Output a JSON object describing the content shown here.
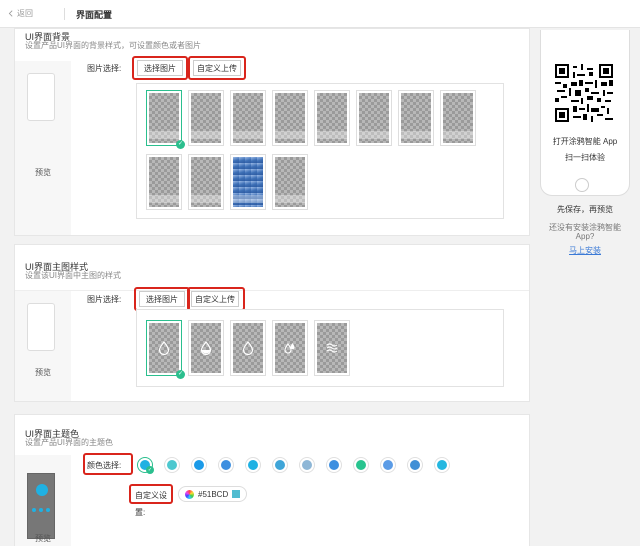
{
  "topbar": {
    "back_label": "返回",
    "title": "界面配置"
  },
  "bg_section": {
    "title": "UI界面背景",
    "desc": "设置产品UI界面的背景样式，可设置颜色或者图片",
    "preview_label": "预览",
    "field_label": "图片选择:",
    "btn_select": "选择图片",
    "btn_upload": "自定义上传",
    "selected_index": 0
  },
  "main_section": {
    "title": "UI界面主图样式",
    "desc": "设置该UI界面中主图的样式",
    "preview_label": "预览",
    "field_label": "图片选择:",
    "btn_select": "选择图片",
    "btn_upload": "自定义上传",
    "icons": [
      "drop-outline-icon",
      "drop-half-icon",
      "drop-outline-icon",
      "two-drops-icon",
      "waves-icon"
    ]
  },
  "theme_section": {
    "title": "UI界面主题色",
    "desc": "设置产品UI界面的主题色",
    "preview_label": "预览",
    "color_label": "颜色选择:",
    "custom_label_1": "自定义设",
    "custom_label_2": "置:",
    "hex_value": "#51BCD",
    "colors": [
      "#1fb1e3",
      "#4dc8cf",
      "#1a9ae8",
      "#3d8fe0",
      "#1fb1e3",
      "#3fa5d8",
      "#8db6d6",
      "#3d8fe0",
      "#28c48f",
      "#5a9be6",
      "#3f8fd6",
      "#24b7e0"
    ]
  },
  "sidebar": {
    "scan_line1": "打开涂鸦智能 App",
    "scan_line2": "扫一扫体验",
    "save_hint": "先保存，再预览",
    "no_app_line1": "还没有安装涂鸦智能",
    "no_app_line2": "App?",
    "install_link": "马上安装"
  }
}
